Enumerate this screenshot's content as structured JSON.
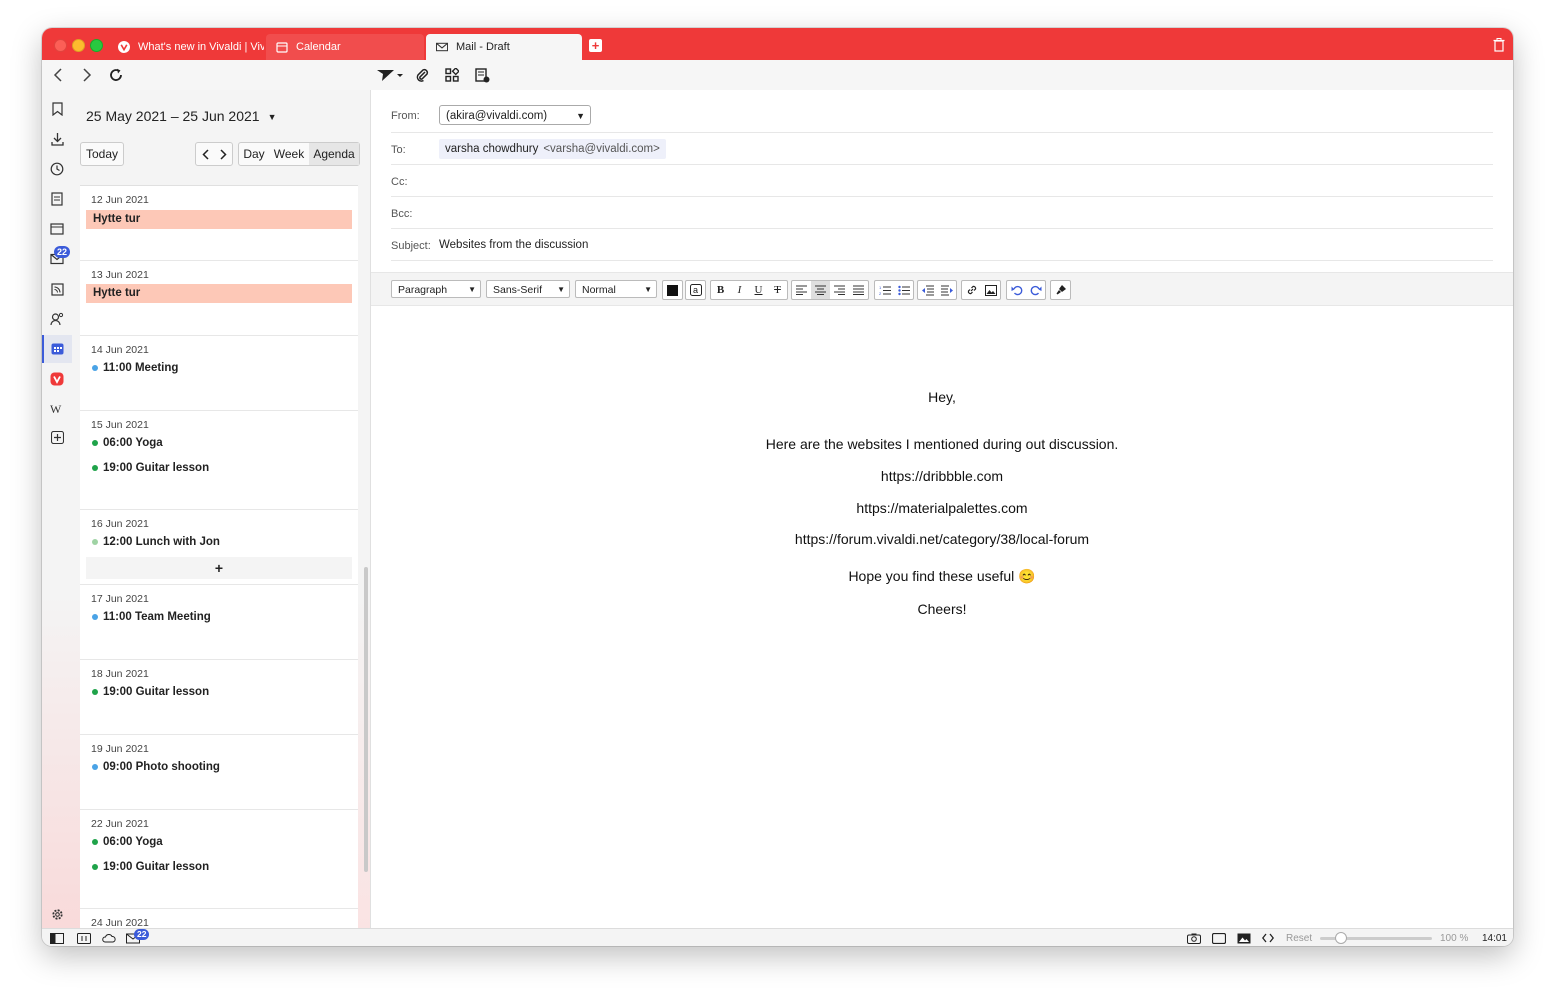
{
  "tabs": [
    {
      "label": "What's new in Vivaldi | Vivaldi Browser",
      "icon": "vivaldi-icon"
    },
    {
      "label": "Calendar",
      "icon": "calendar-icon"
    },
    {
      "label": "Mail - Draft",
      "icon": "mail-icon"
    }
  ],
  "calendar": {
    "range": "25 May 2021 – 25 Jun 2021",
    "today": "Today",
    "views": {
      "day": "Day",
      "week": "Week",
      "agenda": "Agenda"
    },
    "add": "+",
    "days": [
      {
        "date": "12 Jun 2021",
        "events": [
          {
            "title": "Hytte tur"
          }
        ]
      },
      {
        "date": "13 Jun 2021",
        "events": [
          {
            "title": "Hytte tur"
          }
        ]
      },
      {
        "date": "14 Jun 2021",
        "events": [
          {
            "title": "11:00 Meeting"
          }
        ]
      },
      {
        "date": "15 Jun 2021",
        "events": [
          {
            "title": "06:00 Yoga"
          },
          {
            "title": "19:00 Guitar lesson"
          }
        ]
      },
      {
        "date": "16 Jun 2021",
        "events": [
          {
            "title": "12:00 Lunch with Jon"
          }
        ]
      },
      {
        "date": "17 Jun 2021",
        "events": [
          {
            "title": "11:00 Team Meeting"
          }
        ]
      },
      {
        "date": "18 Jun 2021",
        "events": [
          {
            "title": "19:00 Guitar lesson"
          }
        ]
      },
      {
        "date": "19 Jun 2021",
        "events": [
          {
            "title": "09:00 Photo shooting"
          }
        ]
      },
      {
        "date": "22 Jun 2021",
        "events": [
          {
            "title": "06:00 Yoga"
          },
          {
            "title": "19:00 Guitar lesson"
          }
        ]
      },
      {
        "date": "24 Jun 2021",
        "events": []
      }
    ],
    "colors": {
      "allday": "#fdc8b7",
      "blue": "#4aa3e6",
      "green": "#1fa34a",
      "lightgreen": "#9fd3a4"
    }
  },
  "panel": {
    "mail_badge": "22"
  },
  "mail": {
    "from_label": "From:",
    "from_value": "(akira@vivaldi.com)",
    "to_label": "To:",
    "to_name": "varsha chowdhury",
    "to_address": "<varsha@vivaldi.com>",
    "cc_label": "Cc:",
    "bcc_label": "Bcc:",
    "subject_label": "Subject:",
    "subject_value": "Websites from the discussion",
    "format": {
      "paragraph": "Paragraph",
      "font": "Sans-Serif",
      "size": "Normal"
    },
    "body": {
      "greeting": "Hey,",
      "line1": "Here are the websites I mentioned during out discussion.",
      "link1": "https://dribbble.com",
      "link2": "https://materialpalettes.com",
      "link3": "https://forum.vivaldi.net/category/38/local-forum",
      "closing": "Hope you find these useful",
      "emoji": "😊",
      "signoff": "Cheers!"
    }
  },
  "statusbar": {
    "mail_badge": "22",
    "reset": "Reset",
    "zoom": "100 %",
    "clock": "14:01"
  },
  "accent": "#ef3939"
}
